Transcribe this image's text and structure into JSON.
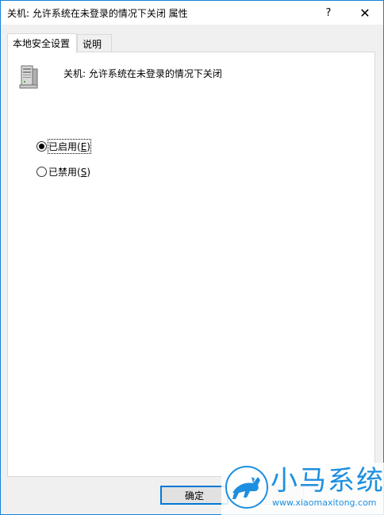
{
  "window": {
    "title": "关机: 允许系统在未登录的情况下关闭 属性",
    "help_glyph": "?",
    "close_glyph": "✕"
  },
  "tabs": [
    {
      "label": "本地安全设置",
      "active": true
    },
    {
      "label": "说明",
      "active": false
    }
  ],
  "policy": {
    "icon": "server-computer-icon",
    "title": "关机: 允许系统在未登录的情况下关闭"
  },
  "options": [
    {
      "label_main": "已启用(",
      "label_key": "E",
      "label_end": ")",
      "selected": true
    },
    {
      "label_main": "已禁用(",
      "label_key": "S",
      "label_end": ")",
      "selected": false
    }
  ],
  "buttons": {
    "ok": "确定",
    "cancel": ""
  },
  "watermark": {
    "text": "小马系统",
    "url": "www.xiaomaxitong.com",
    "color": "#1d8fe0"
  },
  "colors": {
    "accent": "#0078d7",
    "window_border": "#1883d7",
    "background": "#f0f0f0"
  }
}
